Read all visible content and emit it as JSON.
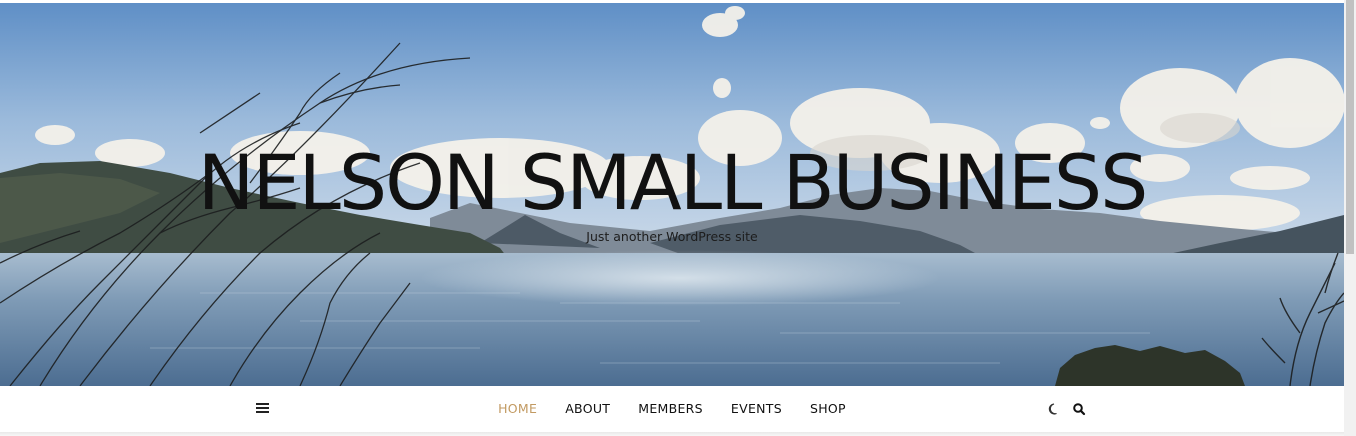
{
  "site": {
    "title": "NELSON SMALL BUSINESS",
    "tagline": "Just another WordPress site"
  },
  "hero": {
    "image": "landscape-sound-with-hills-and-clouds"
  },
  "nav": {
    "items": [
      {
        "label": "HOME",
        "active": true
      },
      {
        "label": "ABOUT",
        "active": false
      },
      {
        "label": "MEMBERS",
        "active": false
      },
      {
        "label": "EVENTS",
        "active": false
      },
      {
        "label": "SHOP",
        "active": false
      }
    ],
    "icons": {
      "menu": "hamburger-menu-icon",
      "theme": "moon-icon",
      "search": "search-icon"
    }
  },
  "colors": {
    "active_nav": "#c29a62",
    "nav_text": "#111111",
    "title_text": "#111111"
  }
}
